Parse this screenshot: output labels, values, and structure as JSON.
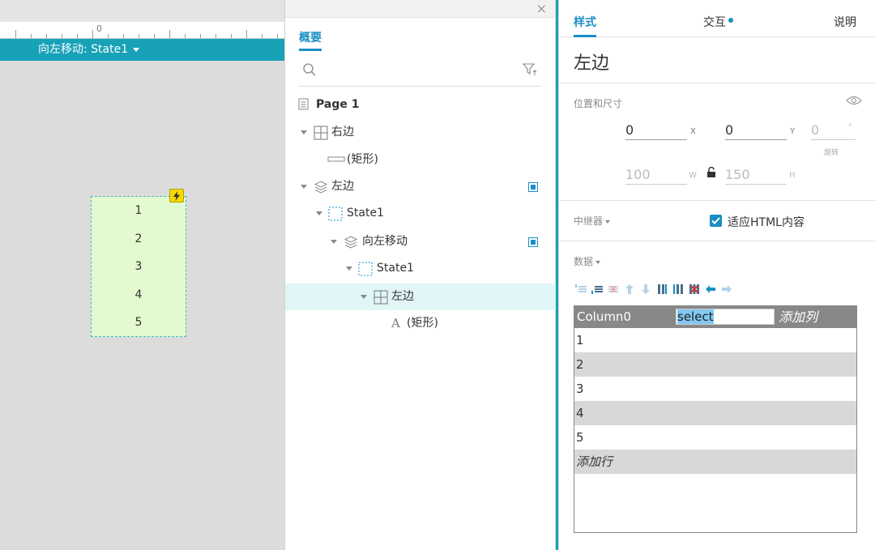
{
  "canvas": {
    "ruler_label": "0",
    "state_bar_label": "向左移动: State1",
    "widget_rows": [
      "1",
      "2",
      "3",
      "4",
      "5"
    ]
  },
  "outline": {
    "tab_label": "概要",
    "tree": [
      {
        "label": "Page 1",
        "icon": "page-icon",
        "bold": true
      },
      {
        "label": "右边",
        "icon": "repeater-icon"
      },
      {
        "label": "(矩形)",
        "icon": "rectangle-icon"
      },
      {
        "label": "左边",
        "icon": "dynamic-panel-icon",
        "flag": true
      },
      {
        "label": "State1",
        "icon": "state-icon"
      },
      {
        "label": "向左移动",
        "icon": "dynamic-panel-icon",
        "flag": true
      },
      {
        "label": "State1",
        "icon": "state-icon"
      },
      {
        "label": "左边",
        "icon": "repeater-icon",
        "selected": true
      },
      {
        "label": "(矩形)",
        "icon": "text-icon"
      }
    ]
  },
  "inspector": {
    "tabs": {
      "style": "样式",
      "interaction": "交互",
      "notes": "说明"
    },
    "title": "左边",
    "position_section": "位置和尺寸",
    "x": {
      "value": "0",
      "unit": "X"
    },
    "y": {
      "value": "0",
      "unit": "Y"
    },
    "rotation": {
      "value": "0",
      "unit": "°",
      "label": "旋转"
    },
    "w": {
      "value": "100",
      "unit": "W"
    },
    "h": {
      "value": "150",
      "unit": "H"
    },
    "repeater_section": "中继器",
    "fit_html": "适应HTML内容",
    "data_section": "数据",
    "grid": {
      "column": "Column0",
      "editing": "select",
      "add_column": "添加列",
      "rows": [
        "1",
        "2",
        "3",
        "4",
        "5"
      ],
      "add_row": "添加行"
    }
  }
}
